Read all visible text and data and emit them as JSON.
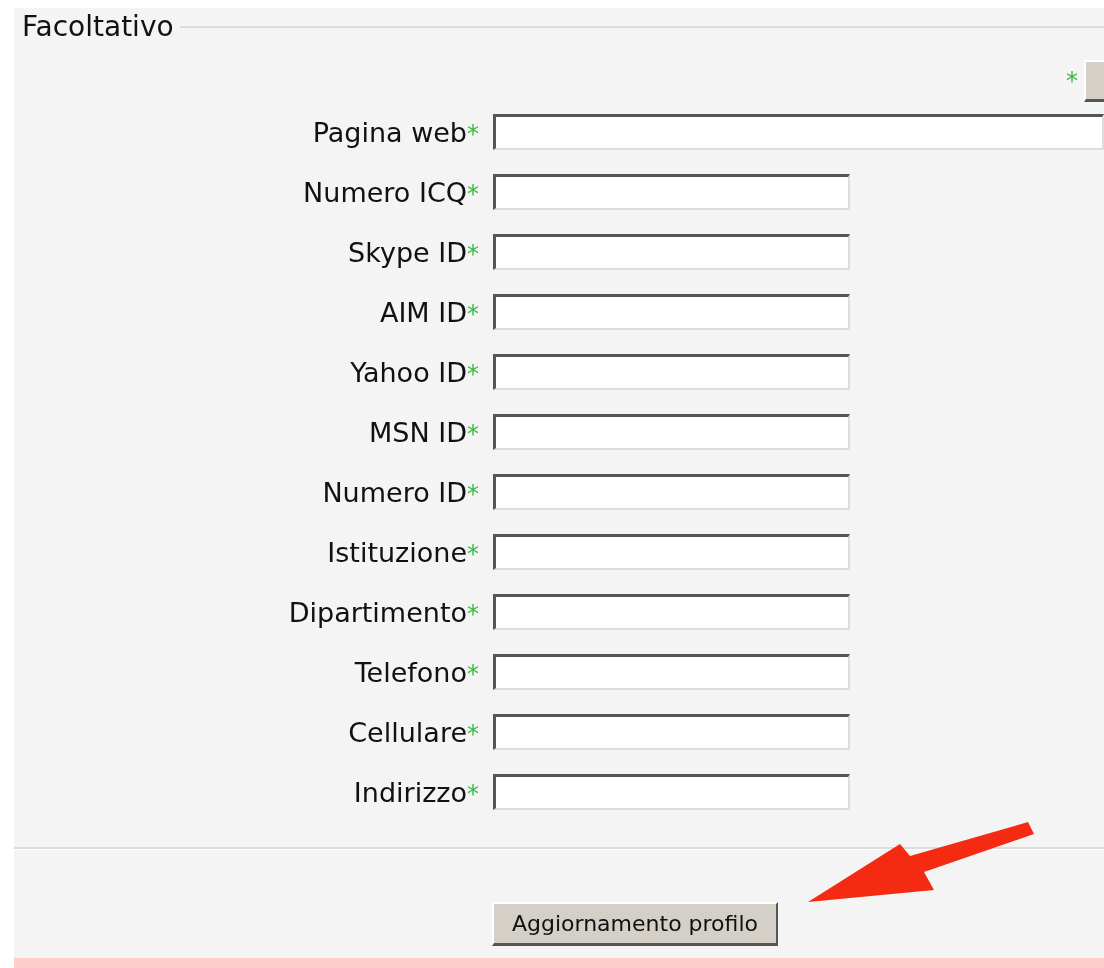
{
  "fieldset": {
    "legend": "Facoltativo"
  },
  "top_control": {
    "mark": "*"
  },
  "fields": [
    {
      "label": "Pagina web",
      "mark": "*",
      "kind": "wide"
    },
    {
      "label": "Numero ICQ",
      "mark": "*",
      "kind": "short"
    },
    {
      "label": "Skype ID",
      "mark": "*",
      "kind": "short"
    },
    {
      "label": "AIM ID",
      "mark": "*",
      "kind": "short"
    },
    {
      "label": "Yahoo ID",
      "mark": "*",
      "kind": "short"
    },
    {
      "label": "MSN ID",
      "mark": "*",
      "kind": "short"
    },
    {
      "label": "Numero ID",
      "mark": "*",
      "kind": "short"
    },
    {
      "label": "Istituzione",
      "mark": "*",
      "kind": "short"
    },
    {
      "label": "Dipartimento",
      "mark": "*",
      "kind": "short"
    },
    {
      "label": "Telefono",
      "mark": "*",
      "kind": "short"
    },
    {
      "label": "Cellulare",
      "mark": "*",
      "kind": "short"
    },
    {
      "label": "Indirizzo",
      "mark": "*",
      "kind": "short"
    }
  ],
  "submit_button": {
    "label": "Aggiornamento profilo"
  }
}
